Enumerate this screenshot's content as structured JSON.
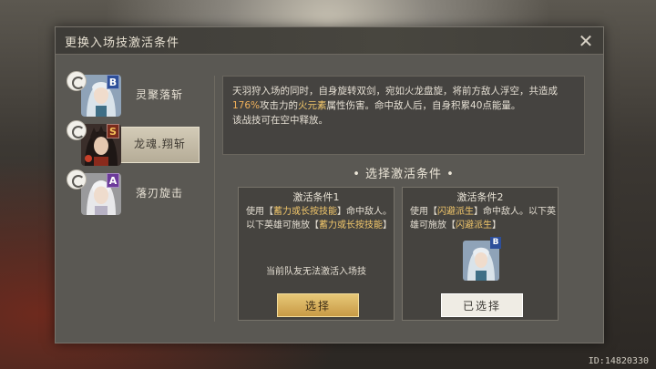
{
  "dialog": {
    "title": "更换入场技激活条件",
    "close_icon": "close-x-icon"
  },
  "skills": [
    {
      "label": "灵聚落斩",
      "rank": "B",
      "selected": false
    },
    {
      "label": "龙魂.翔斩",
      "rank": "S",
      "selected": true
    },
    {
      "label": "落刃旋击",
      "rank": "A",
      "selected": false
    }
  ],
  "description": {
    "part1": "天羽狩入场的同时，自身旋转双剑，宛如火龙盘旋，将前方敌人浮空，共造成",
    "percent": "176%",
    "part2": "攻击力的",
    "element": "火元素",
    "part3": "属性伤害。命中敌人后，自身积累40点能量。",
    "line2": "该战技可在空中释放。"
  },
  "conditions_title": "• 选择激活条件 •",
  "conditions": [
    {
      "title": "激活条件1",
      "text_pre": "使用【",
      "skill": "蓄力或长按技能",
      "text_mid": "】命中敌人。以下英雄可施放【",
      "skill2": "蓄力或长按技能",
      "text_post": "】",
      "note": "当前队友无法激活入场技",
      "button": "选择"
    },
    {
      "title": "激活条件2",
      "text_pre": "使用【",
      "skill": "闪避派生",
      "text_mid": "】命中敌人。以下英雄可施放【",
      "skill2": "闪避派生",
      "text_post": "】",
      "hero_rank": "B",
      "button": "已选择"
    }
  ],
  "footer_id": "ID:14820330",
  "colors": {
    "highlight_orange": "#f0b05a",
    "button_gold": "#c89a45",
    "rank_b": "#2e4f9a",
    "rank_s": "#7a2b1c",
    "rank_a": "#6c3a9a"
  }
}
